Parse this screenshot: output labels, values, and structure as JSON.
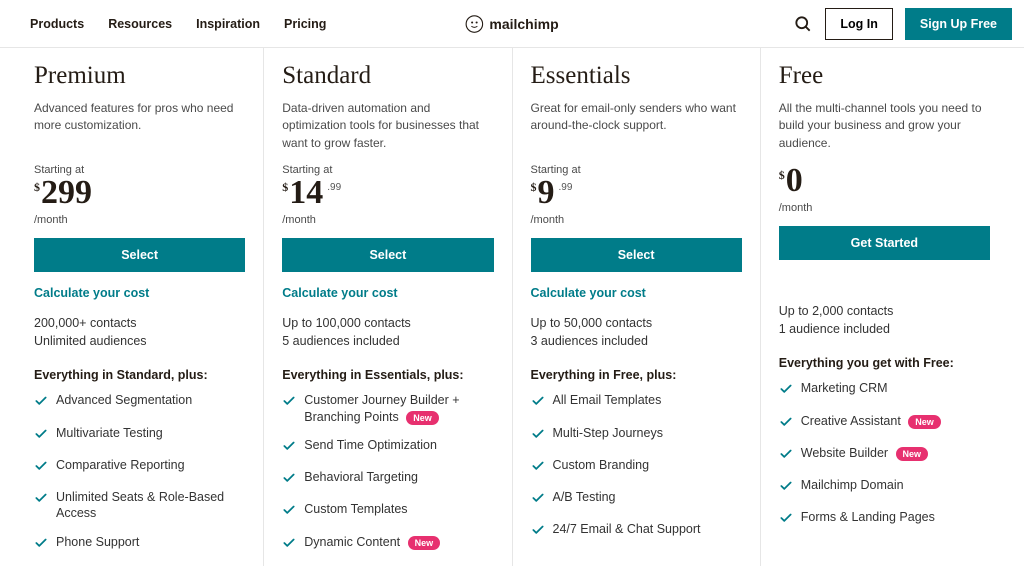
{
  "nav": {
    "products": "Products",
    "resources": "Resources",
    "inspiration": "Inspiration",
    "pricing": "Pricing"
  },
  "brand": "mailchimp",
  "auth": {
    "login": "Log In",
    "signup": "Sign Up Free"
  },
  "common": {
    "starting": "Starting at",
    "permonth": "/month",
    "calc": "Calculate your cost",
    "new": "New"
  },
  "plans": [
    {
      "name": "Premium",
      "desc": "Advanced features for pros who need more customization.",
      "price": "299",
      "cents": "",
      "cta": "Select",
      "showCalc": true,
      "showStarting": true,
      "contacts": "200,000+ contacts",
      "audiences": "Unlimited audiences",
      "everything": "Everything in Standard, plus:",
      "features": [
        {
          "t": "Advanced Segmentation"
        },
        {
          "t": "Multivariate Testing"
        },
        {
          "t": "Comparative Reporting"
        },
        {
          "t": "Unlimited Seats & Role-Based Access"
        },
        {
          "t": "Phone Support"
        }
      ]
    },
    {
      "name": "Standard",
      "desc": "Data-driven automation and optimization tools for businesses that want to grow faster.",
      "price": "14",
      "cents": ".99",
      "cta": "Select",
      "showCalc": true,
      "showStarting": true,
      "contacts": "Up to 100,000 contacts",
      "audiences": "5 audiences included",
      "everything": "Everything in Essentials, plus:",
      "features": [
        {
          "t": "Customer Journey Builder + Branching Points",
          "new": true
        },
        {
          "t": "Send Time Optimization"
        },
        {
          "t": "Behavioral Targeting"
        },
        {
          "t": "Custom Templates"
        },
        {
          "t": "Dynamic Content",
          "new": true
        }
      ]
    },
    {
      "name": "Essentials",
      "desc": "Great for email-only senders who want around-the-clock support.",
      "price": "9",
      "cents": ".99",
      "cta": "Select",
      "showCalc": true,
      "showStarting": true,
      "contacts": "Up to 50,000 contacts",
      "audiences": "3 audiences included",
      "everything": "Everything in Free, plus:",
      "features": [
        {
          "t": "All Email Templates"
        },
        {
          "t": "Multi-Step Journeys"
        },
        {
          "t": "Custom Branding"
        },
        {
          "t": "A/B Testing"
        },
        {
          "t": "24/7 Email & Chat Support"
        }
      ]
    },
    {
      "name": "Free",
      "desc": "All the multi-channel tools you need to build your business and grow your audience.",
      "price": "0",
      "cents": "",
      "cta": "Get Started",
      "showCalc": false,
      "showStarting": false,
      "contacts": "Up to 2,000 contacts",
      "audiences": "1 audience included",
      "everything": "Everything you get with Free:",
      "features": [
        {
          "t": "Marketing CRM"
        },
        {
          "t": "Creative Assistant",
          "new": true
        },
        {
          "t": "Website Builder",
          "new": true
        },
        {
          "t": "Mailchimp Domain"
        },
        {
          "t": "Forms & Landing Pages"
        }
      ]
    }
  ]
}
